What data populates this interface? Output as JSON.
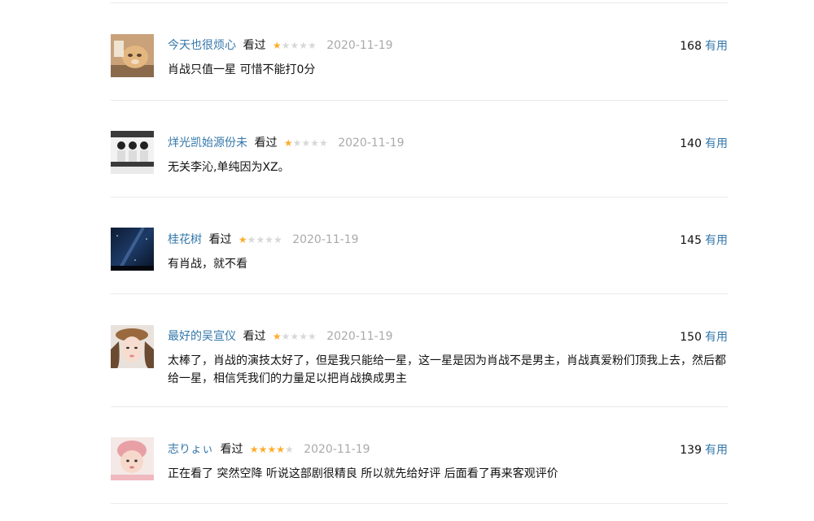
{
  "comments": [
    {
      "author": "今天也很烦心",
      "status": "看过",
      "rating": 1,
      "time": "2020-11-19",
      "votes": "168",
      "vote_label": "有用",
      "text": "肖战只值一星 可惜不能打0分",
      "avatar_icon": "cat-avatar-icon"
    },
    {
      "author": "烊光凯始源份未",
      "status": "看过",
      "rating": 1,
      "time": "2020-11-19",
      "votes": "140",
      "vote_label": "有用",
      "text": "无关李沁,单纯因为XZ。",
      "avatar_icon": "group-photo-avatar-icon"
    },
    {
      "author": "桂花树",
      "status": "看过",
      "rating": 1,
      "time": "2020-11-19",
      "votes": "145",
      "vote_label": "有用",
      "text": "有肖战，就不看",
      "avatar_icon": "night-sky-avatar-icon"
    },
    {
      "author": "最好的吴宣仪",
      "status": "看过",
      "rating": 1,
      "time": "2020-11-19",
      "votes": "150",
      "vote_label": "有用",
      "text": "太棒了，肖战的演技太好了，但是我只能给一星，这一星是因为肖战不是男主，肖战真爱粉们顶我上去，然后都给一星，相信凭我们的力量足以把肖战换成男主",
      "avatar_icon": "girl-portrait-avatar-icon"
    },
    {
      "author": "志りょぃ",
      "status": "看过",
      "rating": 4,
      "time": "2020-11-19",
      "votes": "139",
      "vote_label": "有用",
      "text": "正在看了 突然空降 听说这部剧很精良 所以就先给好评 后面看了再来客观评价",
      "avatar_icon": "baby-portrait-avatar-icon"
    }
  ],
  "colors": {
    "author_link": "#3377aa",
    "star_on": "#ffac2d",
    "star_off": "#d8d8d8",
    "time": "#aaaaaa",
    "divider": "#eaeaea"
  }
}
